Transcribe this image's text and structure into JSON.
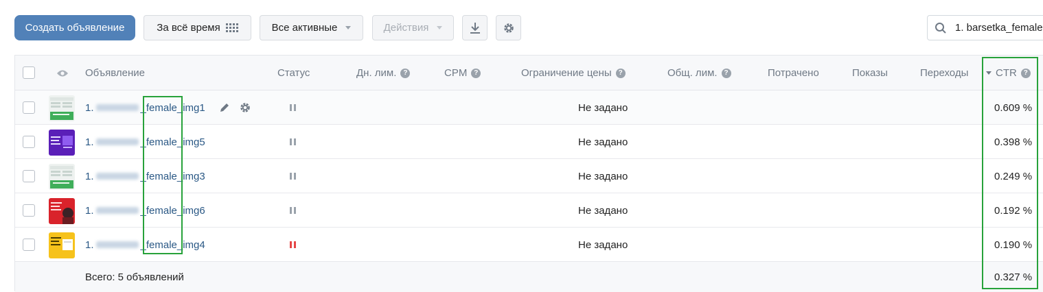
{
  "toolbar": {
    "create_label": "Создать объявление",
    "period_label": "За всё время",
    "status_filter_label": "Все активные",
    "actions_label": "Действия",
    "search_value": "1. barsetka_female"
  },
  "table": {
    "columns": {
      "ad": "Объявление",
      "status": "Статус",
      "day_limit": "Дн. лим.",
      "cpm": "CPM",
      "price_limit": "Ограничение цены",
      "total_limit": "Общ. лим.",
      "spent": "Потрачено",
      "impressions": "Показы",
      "clicks": "Переходы",
      "ctr": "CTR"
    },
    "rows": [
      {
        "prefix": "1.",
        "suffix": "_female_img1",
        "status": "paused",
        "price_limit": "Не задано",
        "ctr": "0.609 %"
      },
      {
        "prefix": "1.",
        "suffix": "_female_img5",
        "status": "paused",
        "price_limit": "Не задано",
        "ctr": "0.398 %"
      },
      {
        "prefix": "1.",
        "suffix": "_female_img3",
        "status": "paused",
        "price_limit": "Не задано",
        "ctr": "0.249 %"
      },
      {
        "prefix": "1.",
        "suffix": "_female_img6",
        "status": "paused",
        "price_limit": "Не задано",
        "ctr": "0.192 %"
      },
      {
        "prefix": "1.",
        "suffix": "_female_img4",
        "status": "stopped",
        "price_limit": "Не задано",
        "ctr": "0.190 %"
      }
    ],
    "footer": {
      "total_label": "Всего: 5 объявлений",
      "ctr": "0.327 %"
    }
  },
  "colors": {
    "primary": "#5181b8",
    "highlight": "#27a23a",
    "paused": "#9aa2ab",
    "stopped": "#e64646"
  }
}
